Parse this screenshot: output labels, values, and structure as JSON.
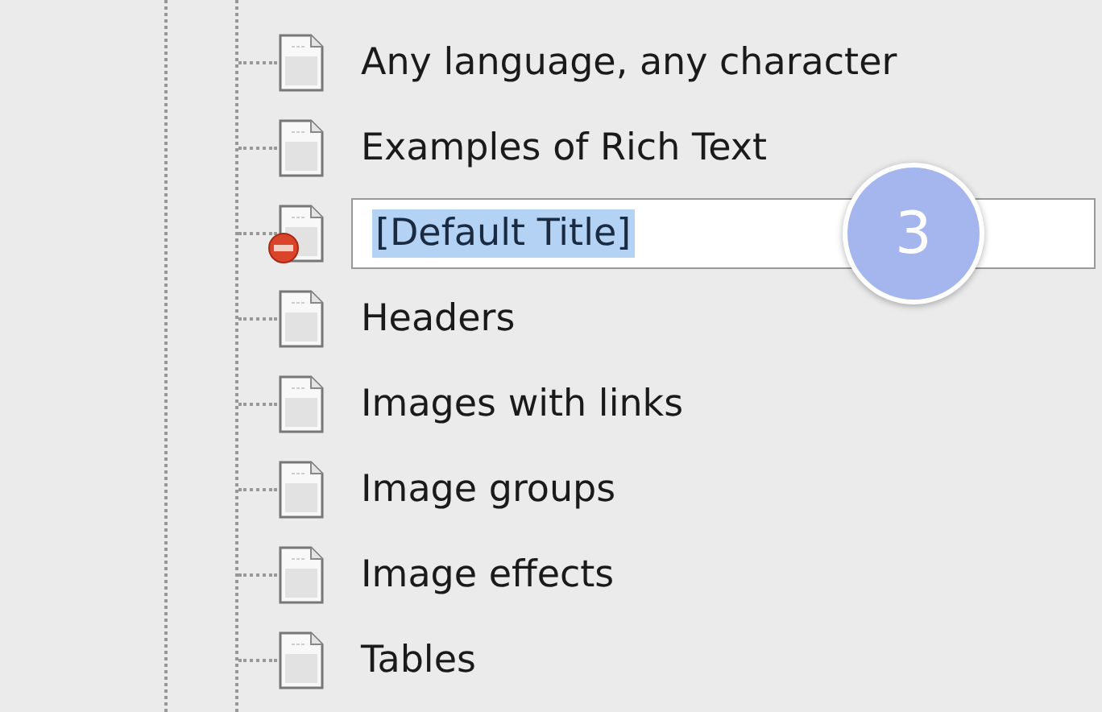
{
  "tree": {
    "items": [
      {
        "kind": "page",
        "label": "Any language, any character"
      },
      {
        "kind": "page",
        "label": "Examples of Rich Text"
      },
      {
        "kind": "editing",
        "value": "[Default Title]",
        "text_selected": true,
        "blocked": true,
        "badge": "3"
      },
      {
        "kind": "page",
        "label": "Headers"
      },
      {
        "kind": "page",
        "label": "Images with links"
      },
      {
        "kind": "page",
        "label": "Image groups"
      },
      {
        "kind": "page",
        "label": "Image effects"
      },
      {
        "kind": "page",
        "label": "Tables"
      }
    ]
  }
}
